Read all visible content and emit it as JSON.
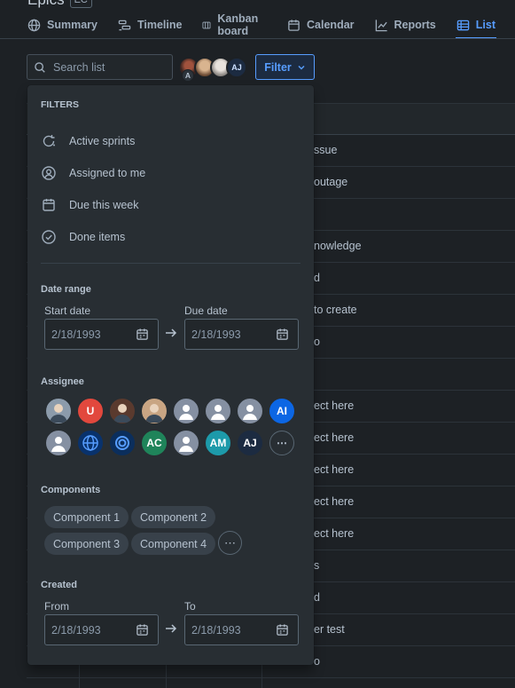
{
  "project": {
    "title": "Epics",
    "badge": "EC"
  },
  "tabs": [
    {
      "label": "Summary",
      "icon": "globe-icon"
    },
    {
      "label": "Timeline",
      "icon": "timeline-icon"
    },
    {
      "label": "Kanban board",
      "icon": "board-icon"
    },
    {
      "label": "Calendar",
      "icon": "calendar-icon"
    },
    {
      "label": "Reports",
      "icon": "chart-line-icon"
    },
    {
      "label": "List",
      "icon": "list-icon",
      "active": true
    }
  ],
  "search": {
    "placeholder": "Search list"
  },
  "toolbar": {
    "avatar_initials": "AJ",
    "avatar_badge": "A",
    "filter_label": "Filter"
  },
  "list_rows": [
    "ssue",
    "outage",
    "",
    "nowledge",
    "d",
    "to create",
    "o",
    "",
    "ect here",
    "ect here",
    "ect here",
    "ect here",
    "ect here",
    "s",
    "d",
    "er test",
    "o",
    ""
  ],
  "filters": {
    "heading": "FILTERS",
    "quick": [
      {
        "label": "Active sprints",
        "icon": "sprint-icon"
      },
      {
        "label": "Assigned to me",
        "icon": "person-circle-icon"
      },
      {
        "label": "Due this week",
        "icon": "calendar-icon"
      },
      {
        "label": "Done items",
        "icon": "check-circle-icon"
      }
    ],
    "date_range": {
      "heading": "Date range",
      "start_label": "Start date",
      "start_value": "2/18/1993",
      "due_label": "Due date",
      "due_value": "2/18/1993"
    },
    "assignee": {
      "heading": "Assignee",
      "row1": [
        {
          "kind": "photo",
          "initials": "",
          "color": "#8c9bab"
        },
        {
          "kind": "initials",
          "initials": "U",
          "color": "#e2483d"
        },
        {
          "kind": "photo",
          "initials": "",
          "color": "#5a3a2e"
        },
        {
          "kind": "photo",
          "initials": "",
          "color": "#c9a583"
        },
        {
          "kind": "default",
          "initials": "",
          "color": "#8590a2"
        },
        {
          "kind": "default",
          "initials": "",
          "color": "#8590a2"
        },
        {
          "kind": "default",
          "initials": "",
          "color": "#8590a2"
        },
        {
          "kind": "initials",
          "initials": "AI",
          "color": "#0c66e4"
        }
      ],
      "row2": [
        {
          "kind": "default",
          "initials": "",
          "color": "#8590a2"
        },
        {
          "kind": "globe",
          "initials": "",
          "color": "#09326c"
        },
        {
          "kind": "ring",
          "initials": "",
          "color": "#0b2e5c"
        },
        {
          "kind": "initials",
          "initials": "AC",
          "color": "#1f845a"
        },
        {
          "kind": "default",
          "initials": "",
          "color": "#8590a2"
        },
        {
          "kind": "initials",
          "initials": "AM",
          "color": "#1d9aaa"
        },
        {
          "kind": "initials",
          "initials": "AJ",
          "color": "#1c2b41"
        }
      ],
      "more": "⋯"
    },
    "components": {
      "heading": "Components",
      "items": [
        "Component 1",
        "Component 2",
        "Component 3",
        "Component 4"
      ],
      "more": "⋯"
    },
    "created": {
      "heading": "Created",
      "from_label": "From",
      "from_value": "2/18/1993",
      "to_label": "To",
      "to_value": "2/18/1993"
    }
  }
}
